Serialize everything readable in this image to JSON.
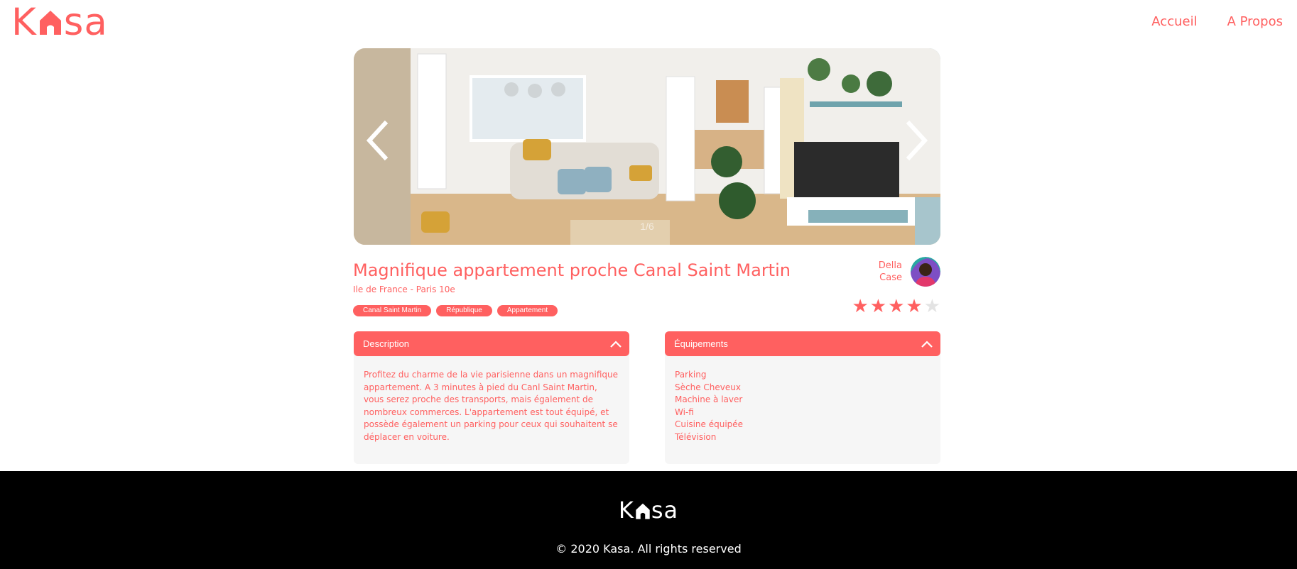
{
  "header": {
    "logo": {
      "prefix": "K",
      "suffix": "sa"
    },
    "nav": {
      "home": "Accueil",
      "about": "A Propos"
    }
  },
  "carousel": {
    "counter": "1/6",
    "image_count": 6,
    "current_image": 1
  },
  "listing": {
    "title": "Magnifique appartement proche Canal Saint Martin",
    "location": "Ile de France - Paris 10e",
    "tags": [
      "Canal Saint Martin",
      "République",
      "Appartement"
    ],
    "host": {
      "first_name": "Della",
      "last_name": "Case"
    },
    "rating": 4,
    "rating_max": 5
  },
  "description": {
    "title": "Description",
    "text": "Profitez du charme de la vie parisienne dans un magnifique appartement. A 3 minutes à pied du Canl Saint Martin, vous serez proche des transports, mais également de nombreux commerces. L'appartement est tout équipé, et possède également un parking pour ceux qui souhaitent se déplacer en voiture."
  },
  "equipments": {
    "title": "Équipements",
    "items": [
      "Parking",
      "Sèche Cheveux",
      "Machine à laver",
      "Wi-fi",
      "Cuisine équipée",
      "Télévision"
    ]
  },
  "footer": {
    "logo": {
      "prefix": "K",
      "suffix": "sa"
    },
    "copyright": "© 2020 Kasa. All rights reserved"
  },
  "colors": {
    "accent": "#FF6060",
    "panel": "#F6F6F6",
    "footer": "#000000",
    "star_off": "#E3E3E3"
  },
  "icons": [
    "house-icon",
    "chevron-left-icon",
    "chevron-right-icon",
    "chevron-up-icon",
    "star-icon"
  ]
}
